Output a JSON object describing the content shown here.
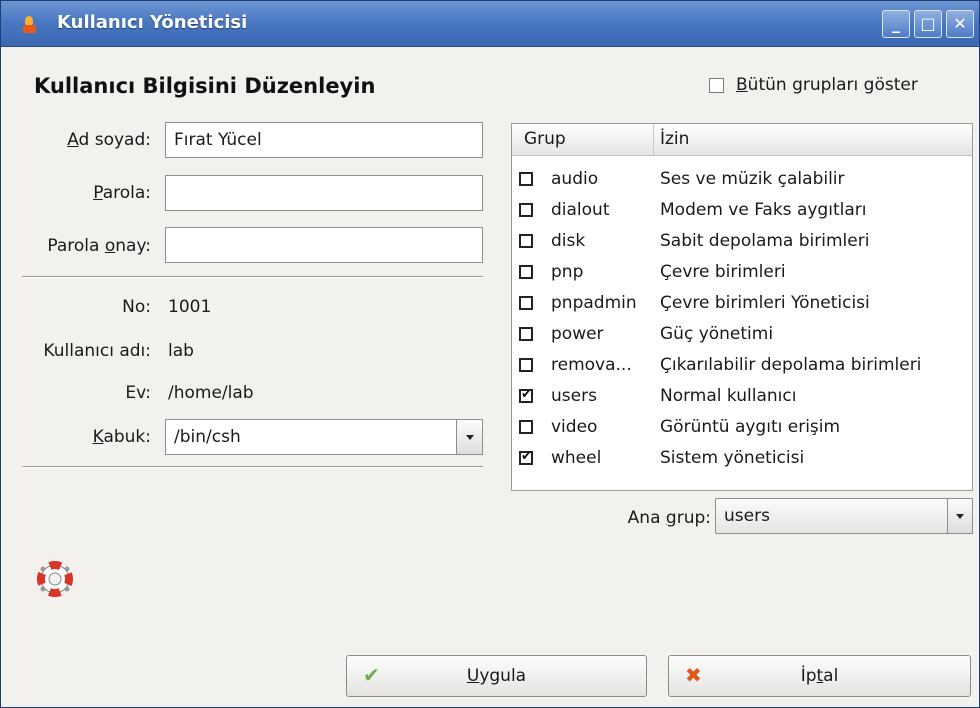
{
  "window": {
    "title": "Kullanıcı Yöneticisi",
    "controls": {
      "minimize": "_",
      "maximize": "□",
      "close": "✕"
    }
  },
  "heading": "Kullanıcı Bilgisini Düzenleyin",
  "show_all_groups": {
    "label_u": "B",
    "label_rest": "ütün grupları göster",
    "checked": false
  },
  "form": {
    "fullname": {
      "label_u": "A",
      "label_rest": "d soyad:",
      "value": "Fırat Yücel"
    },
    "password": {
      "label_u": "P",
      "label_rest": "arola:",
      "value": ""
    },
    "password_confirm": {
      "label_pre": "Parola ",
      "label_u": "o",
      "label_rest": "nay:",
      "value": ""
    },
    "uid": {
      "label": "No:",
      "value": "1001"
    },
    "username": {
      "label": "Kullanıcı adı:",
      "value": "lab"
    },
    "home": {
      "label": "Ev:",
      "value": "/home/lab"
    },
    "shell": {
      "label_u": "K",
      "label_rest": "abuk:",
      "value": "/bin/csh"
    }
  },
  "groups_table": {
    "columns": [
      "Grup",
      "İzin"
    ],
    "rows": [
      {
        "group": "audio",
        "permission": "Ses ve müzik çalabilir",
        "checked": false
      },
      {
        "group": "dialout",
        "permission": "Modem ve Faks aygıtları",
        "checked": false
      },
      {
        "group": "disk",
        "permission": "Sabit depolama birimleri",
        "checked": false
      },
      {
        "group": "pnp",
        "permission": "Çevre birimleri",
        "checked": false
      },
      {
        "group": "pnpadmin",
        "permission": "Çevre birimleri Yöneticisi",
        "checked": false
      },
      {
        "group": "power",
        "permission": "Güç yönetimi",
        "checked": false
      },
      {
        "group": "remova...",
        "permission": "Çıkarılabilir depolama birimleri",
        "checked": false
      },
      {
        "group": "users",
        "permission": "Normal kullanıcı",
        "checked": true
      },
      {
        "group": "video",
        "permission": "Görüntü aygıtı erişim",
        "checked": false
      },
      {
        "group": "wheel",
        "permission": "Sistem yöneticisi",
        "checked": true
      }
    ]
  },
  "main_group": {
    "label_pre": "Ana ",
    "label_u": "g",
    "label_rest": "rup:",
    "value": "users"
  },
  "buttons": {
    "apply": {
      "label_u": "U",
      "label_rest": "ygula",
      "icon": "checkmark-icon"
    },
    "cancel": {
      "label_pre": "İp",
      "label_u": "t",
      "label_rest": "al",
      "icon": "cross-icon"
    }
  },
  "colors": {
    "titlebar": "#4a78c2",
    "apply_icon": "#6ab04c",
    "cancel_icon": "#e0561c"
  }
}
